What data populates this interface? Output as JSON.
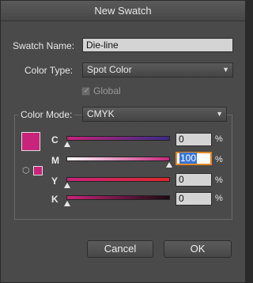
{
  "window": {
    "title": "New Swatch"
  },
  "swatch_name": {
    "label": "Swatch Name:",
    "value": "Die-line"
  },
  "color_type": {
    "label": "Color Type:",
    "value": "Spot Color"
  },
  "global": {
    "label": "Global",
    "checked": true,
    "enabled": false
  },
  "color_mode": {
    "label": "Color Mode:",
    "value": "CMYK"
  },
  "swatch_color": "#c8247b",
  "channels": [
    {
      "name": "C",
      "value": "0",
      "percent": "%"
    },
    {
      "name": "M",
      "value": "100",
      "percent": "%"
    },
    {
      "name": "Y",
      "value": "0",
      "percent": "%"
    },
    {
      "name": "K",
      "value": "0",
      "percent": "%"
    }
  ],
  "buttons": {
    "cancel": "Cancel",
    "ok": "OK"
  },
  "icons": {
    "dropdown": "chevron-down-icon",
    "gamut": "cube-icon"
  }
}
